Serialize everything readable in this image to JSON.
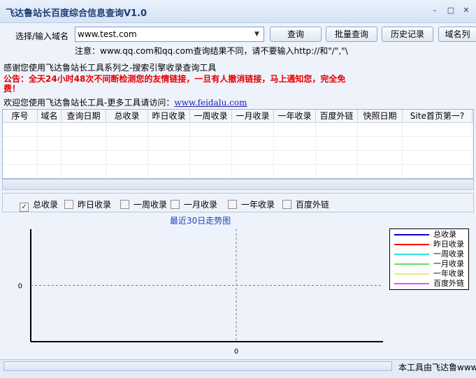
{
  "window": {
    "title": "飞达鲁站长百度综合信息查询V1.0",
    "minimize": "–",
    "maximize": "□",
    "close": "✕"
  },
  "domain": {
    "label": "选择/输入域名",
    "value": "www.test.com",
    "dropdown_icon": "▼"
  },
  "buttons": {
    "query": "查询",
    "batch": "批量查询",
    "history": "历史记录",
    "domain_list": "域名列"
  },
  "note": "注意：www.qq.com和qq.com查询结果不同，请不要输入http://和\"/\",\"\\",
  "thanks": "感谢您使用飞达鲁站长工具系列之-搜索引擎收录查询工具",
  "notice": "公告：全天24小时48次不间断检测您的友情链接，一旦有人撤消链接，马上通知您，完全免费！",
  "welcome": {
    "text": "欢迎您使用飞达鲁站长工具-更多工具请访问：",
    "link": "www.feidalu.com"
  },
  "table": {
    "columns": [
      "序号",
      "域名",
      "查询日期",
      "总收录",
      "昨日收录",
      "一周收录",
      "一月收录",
      "一年收录",
      "百度外链",
      "快照日期",
      "Site首页第一?"
    ],
    "rows": []
  },
  "checkboxes": [
    {
      "label": "总收录",
      "checked": true
    },
    {
      "label": "昨日收录",
      "checked": false
    },
    {
      "label": "一周收录",
      "checked": false
    },
    {
      "label": "一月收录",
      "checked": false
    },
    {
      "label": "一年收录",
      "checked": false
    },
    {
      "label": "百度外链",
      "checked": false
    }
  ],
  "chart_data": {
    "type": "line",
    "title": "最近30日走势图",
    "x": [
      0
    ],
    "xticks": [
      "0"
    ],
    "yticks": [
      "0"
    ],
    "grid": true,
    "legend_position": "top-right",
    "series": [
      {
        "name": "总收录",
        "color": "#0000cc",
        "values": []
      },
      {
        "name": "昨日收录",
        "color": "#ff0000",
        "values": []
      },
      {
        "name": "一周收录",
        "color": "#33dddd",
        "values": []
      },
      {
        "name": "一月收录",
        "color": "#66dd66",
        "values": []
      },
      {
        "name": "一年收录",
        "color": "#eeee66",
        "values": []
      },
      {
        "name": "百度外链",
        "color": "#ff44ff",
        "values": []
      }
    ]
  },
  "status": {
    "text": "本工具由飞达鲁www"
  }
}
